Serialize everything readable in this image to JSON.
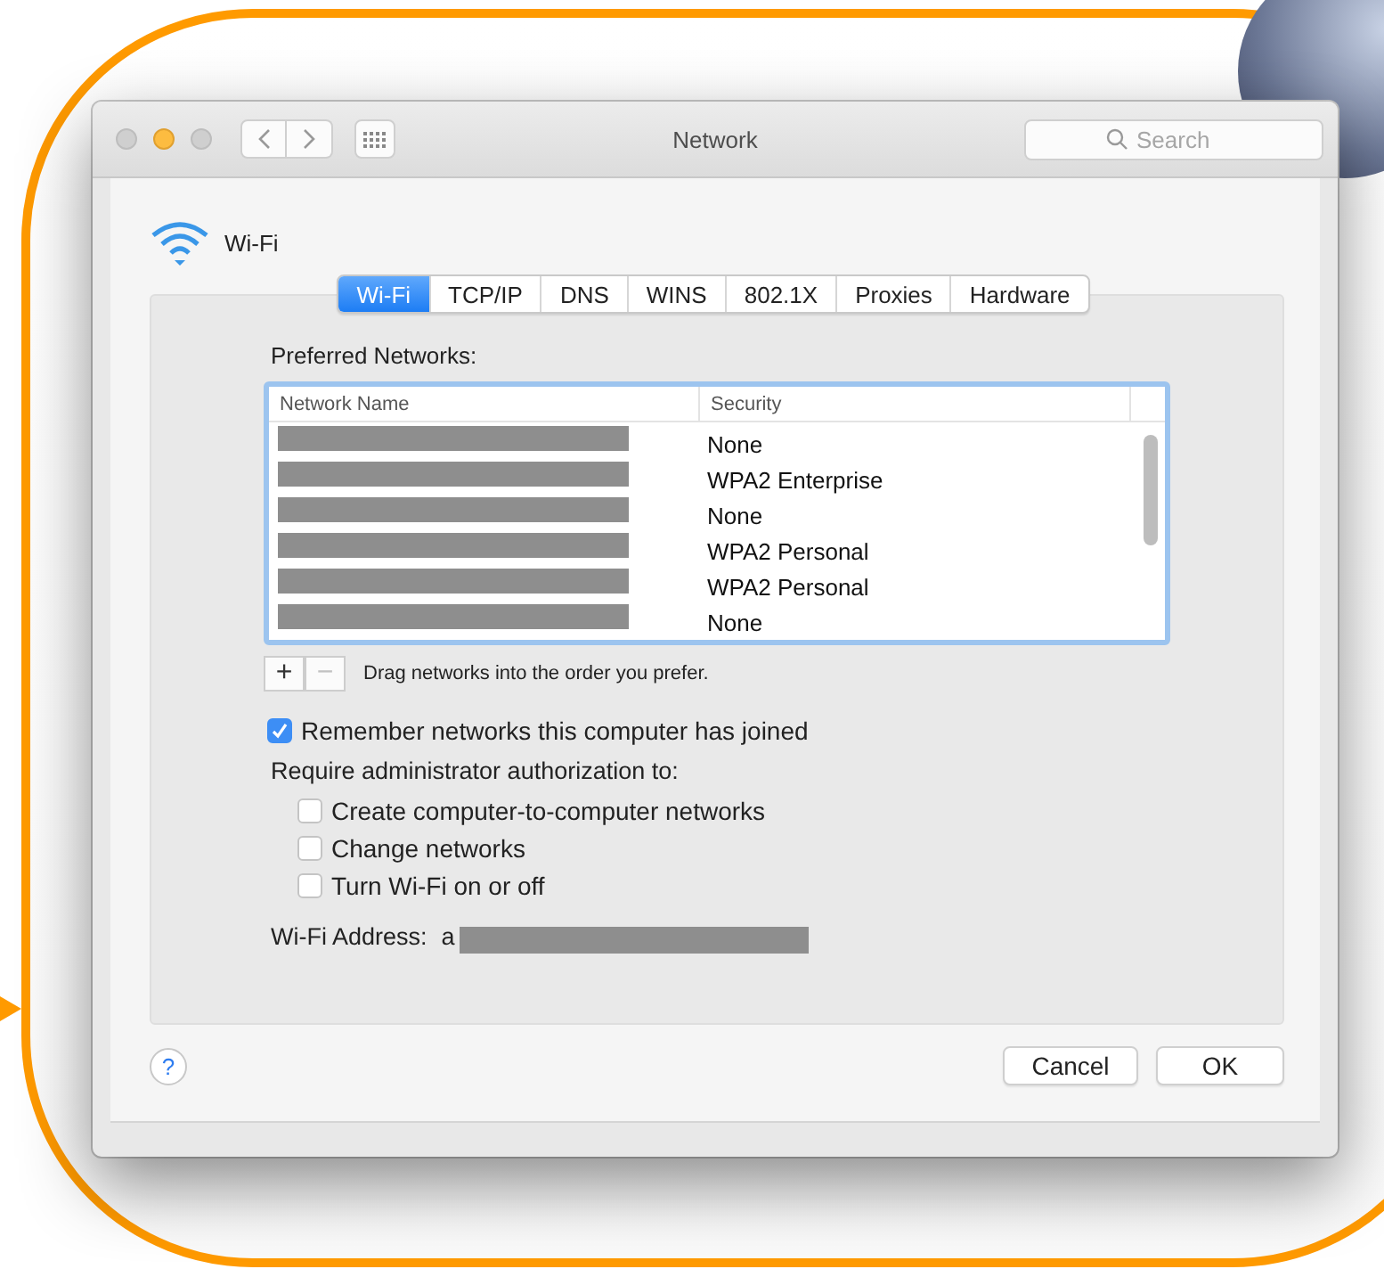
{
  "window": {
    "title": "Network",
    "search": {
      "placeholder": "Search"
    }
  },
  "service": {
    "name": "Wi-Fi"
  },
  "tabs": [
    {
      "label": "Wi-Fi",
      "selected": true
    },
    {
      "label": "TCP/IP",
      "selected": false
    },
    {
      "label": "DNS",
      "selected": false
    },
    {
      "label": "WINS",
      "selected": false
    },
    {
      "label": "802.1X",
      "selected": false
    },
    {
      "label": "Proxies",
      "selected": false
    },
    {
      "label": "Hardware",
      "selected": false
    }
  ],
  "preferred_networks": {
    "label": "Preferred Networks:",
    "columns": [
      "Network Name",
      "Security"
    ],
    "rows": [
      {
        "security": "None"
      },
      {
        "security": "WPA2 Enterprise"
      },
      {
        "security": "None"
      },
      {
        "security": "WPA2 Personal"
      },
      {
        "security": "WPA2 Personal"
      },
      {
        "security": "None"
      }
    ],
    "add_button": {
      "label": "+",
      "disabled": false
    },
    "remove_button": {
      "label": "−",
      "disabled": true
    },
    "hint": "Drag networks into the order you prefer."
  },
  "remember": {
    "label": "Remember networks this computer has joined",
    "checked": true
  },
  "require_label": "Require administrator authorization to:",
  "require_options": [
    {
      "label": "Create computer-to-computer networks",
      "checked": false
    },
    {
      "label": "Change networks",
      "checked": false
    },
    {
      "label": "Turn Wi-Fi on or off",
      "checked": false
    }
  ],
  "wifi_address": {
    "label": "Wi-Fi Address:",
    "value": "a"
  },
  "help": "?",
  "buttons": [
    {
      "label": "Cancel"
    },
    {
      "label": "OK"
    }
  ]
}
